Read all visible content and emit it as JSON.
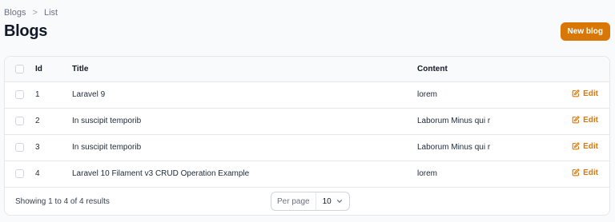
{
  "breadcrumb": {
    "items": [
      "Blogs",
      "List"
    ],
    "separator": ">"
  },
  "page": {
    "title": "Blogs",
    "new_button_label": "New blog"
  },
  "table": {
    "columns": {
      "id": "Id",
      "title": "Title",
      "content": "Content"
    },
    "rows": [
      {
        "id": "1",
        "title": "Laravel 9",
        "content": "lorem",
        "action": "Edit"
      },
      {
        "id": "2",
        "title": "In suscipit temporib",
        "content": "Laborum Minus qui r",
        "action": "Edit"
      },
      {
        "id": "3",
        "title": "In suscipit temporib",
        "content": "Laborum Minus qui r",
        "action": "Edit"
      },
      {
        "id": "4",
        "title": "Laravel 10 Filament v3 CRUD Operation Example",
        "content": "lorem",
        "action": "Edit"
      }
    ]
  },
  "footer": {
    "results_text": "Showing 1 to 4 of 4 results",
    "per_page_label": "Per page",
    "per_page_value": "10"
  },
  "colors": {
    "accent": "#d97706",
    "border": "#e5e7eb",
    "background": "#f9fafb"
  }
}
